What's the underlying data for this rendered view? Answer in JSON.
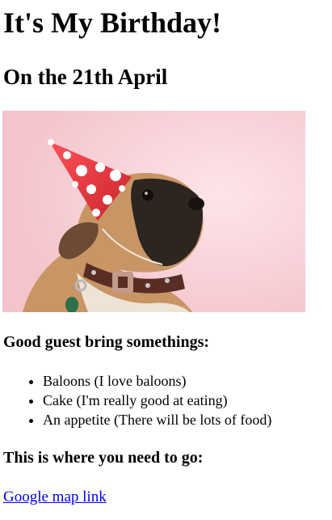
{
  "header": {
    "title": "It's My Birthday!",
    "date": "On the 21th April"
  },
  "photo": {
    "subject": "pug-in-party-hat",
    "colors": {
      "background": "#f7ccd3",
      "hat": "#e42d34",
      "hat_dots": "#ffffff",
      "fur": "#c89565",
      "mask": "#2c2520",
      "collar": "#5a2d24"
    }
  },
  "guests": {
    "heading": "Good guest bring somethings:",
    "items": [
      "Baloons (I love baloons)",
      "Cake (I'm really good at eating)",
      "An appetite (There will be lots of food)"
    ]
  },
  "location": {
    "heading": "This is where you need to go:",
    "link_text": "Google map link",
    "link_color": "#0000ee"
  }
}
